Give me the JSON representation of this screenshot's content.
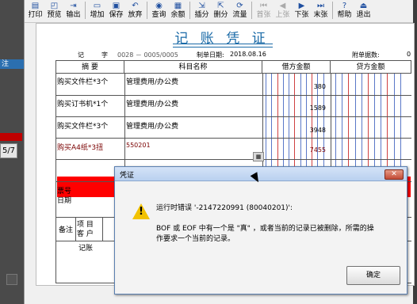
{
  "left_panel": {
    "strip_label": "注",
    "page_indicator": "5/7"
  },
  "toolbar": {
    "buttons": [
      {
        "label": "打印",
        "icon": "printer-icon",
        "glyph": "▤",
        "enabled": true
      },
      {
        "label": "预览",
        "icon": "preview-icon",
        "glyph": "◰",
        "enabled": true
      },
      {
        "label": "输出",
        "icon": "export-icon",
        "glyph": "⇥",
        "enabled": true
      },
      {
        "label": "增加",
        "icon": "add-icon",
        "glyph": "▭",
        "enabled": true
      },
      {
        "label": "保存",
        "icon": "save-icon",
        "glyph": "▣",
        "enabled": true
      },
      {
        "label": "放弃",
        "icon": "undo-icon",
        "glyph": "↶",
        "enabled": true
      },
      {
        "label": "查询",
        "icon": "binoculars-icon",
        "glyph": "◉",
        "enabled": true
      },
      {
        "label": "余额",
        "icon": "balance-icon",
        "glyph": "▦",
        "enabled": true
      },
      {
        "label": "插分",
        "icon": "insert-row-icon",
        "glyph": "⇲",
        "enabled": true
      },
      {
        "label": "删分",
        "icon": "delete-row-icon",
        "glyph": "⇱",
        "enabled": true
      },
      {
        "label": "流量",
        "icon": "cashflow-icon",
        "glyph": "⟳",
        "enabled": true
      },
      {
        "label": "首张",
        "icon": "first-icon",
        "glyph": "⏮",
        "enabled": false
      },
      {
        "label": "上张",
        "icon": "prev-icon",
        "glyph": "◀",
        "enabled": false
      },
      {
        "label": "下张",
        "icon": "next-icon",
        "glyph": "▶",
        "enabled": true
      },
      {
        "label": "末张",
        "icon": "last-icon",
        "glyph": "⏭",
        "enabled": true
      },
      {
        "label": "帮助",
        "icon": "help-icon",
        "glyph": "?",
        "enabled": true
      },
      {
        "label": "退出",
        "icon": "exit-icon",
        "glyph": "⏏",
        "enabled": true
      }
    ]
  },
  "voucher": {
    "title": "记 账 凭 证",
    "type_label": "记",
    "zi_label": "字",
    "number": "0028 － 0005/0005",
    "date_label": "制单日期:",
    "date": "2018.08.16",
    "attach_label": "附单据数:",
    "attach_count": "0",
    "headers": {
      "summary": "摘 要",
      "account": "科目名称",
      "debit": "借方金额",
      "credit": "贷方金额"
    },
    "rows": [
      {
        "summary": "购买文件栏*3个",
        "account": "管理费用/办公费",
        "debit": "380",
        "credit": ""
      },
      {
        "summary": "购买订书机*1个",
        "account": "管理费用/办公费",
        "debit": "1589",
        "credit": ""
      },
      {
        "summary": "购买文件栏*3个",
        "account": "管理费用/办公费",
        "debit": "3948",
        "credit": ""
      },
      {
        "summary": "购买A4纸*3扭",
        "account": "550201",
        "debit": "7455",
        "credit": ""
      }
    ],
    "footer": {
      "ticket_no": "票号",
      "date": "日期",
      "remark": "备注",
      "project": "项 目",
      "customer": "客 户",
      "bookkeeper": "记账"
    }
  },
  "dialog": {
    "title": "凭证",
    "line1": "运行时错误 '-2147220991 (80040201)':",
    "line2": "BOF 或 EOF 中有一个是 \"真\" ，或者当前的记录已被删除，所需的操",
    "line3": "作要求一个当前的记录。",
    "ok": "确定"
  },
  "colors": {
    "title_blue": "#1a6aa7",
    "selected_row_red": "#ff0000",
    "warning_yellow": "#f2c200"
  }
}
